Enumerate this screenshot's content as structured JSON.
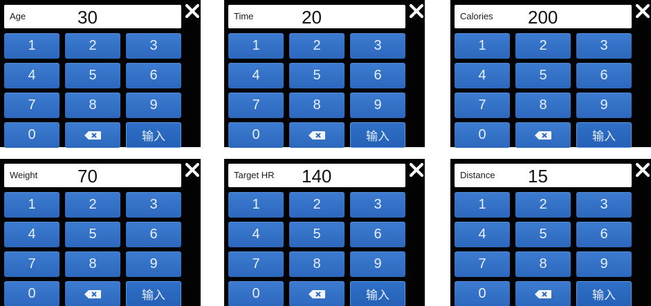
{
  "colors": {
    "panel_bg": "#020202",
    "key_blue": "#3573c6",
    "field_bg": "#ffffff",
    "close_icon": "#ffffff"
  },
  "panels": [
    {
      "label": "Age",
      "value": "30"
    },
    {
      "label": "Time",
      "value": "20"
    },
    {
      "label": "Calories",
      "value": "200"
    },
    {
      "label": "Weight",
      "value": "70"
    },
    {
      "label": "Target HR",
      "value": "140"
    },
    {
      "label": "Distance",
      "value": "15"
    }
  ],
  "keypad": {
    "digits": [
      "1",
      "2",
      "3",
      "4",
      "5",
      "6",
      "7",
      "8",
      "9"
    ],
    "zero": "0",
    "backspace_icon": "backspace-icon",
    "enter_label": "输入"
  },
  "close_icon": "close-icon"
}
